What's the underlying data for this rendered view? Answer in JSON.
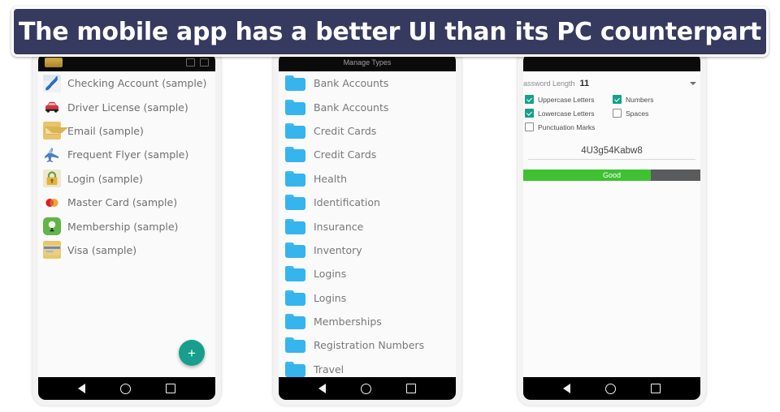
{
  "banner": {
    "text": "The mobile app has a better UI than its PC counterpart",
    "bg_color": "#373a5f",
    "text_color": "#ffffff"
  },
  "phones": {
    "entries_phone": {
      "topbar": {
        "title": "",
        "thumb_icon": "yellow-thumbnail-icon",
        "menu_icon": "overflow-menu-icon"
      },
      "entries": [
        {
          "label": "Checking Account (sample)",
          "icon": "checkbook-icon"
        },
        {
          "label": "Driver License (sample)",
          "icon": "car-icon"
        },
        {
          "label": "Email (sample)",
          "icon": "envelope-icon"
        },
        {
          "label": "Frequent Flyer (sample)",
          "icon": "airplane-icon"
        },
        {
          "label": "Login (sample)",
          "icon": "padlock-icon"
        },
        {
          "label": "Master Card (sample)",
          "icon": "mastercard-icon"
        },
        {
          "label": "Membership (sample)",
          "icon": "golf-ball-icon"
        },
        {
          "label": "Visa (sample)",
          "icon": "visa-card-icon"
        }
      ],
      "fab": {
        "label": "+",
        "color": "#179e8d"
      },
      "navbar": {
        "back": "back-icon",
        "home": "home-icon",
        "recents": "recents-icon"
      }
    },
    "types_phone": {
      "topbar": {
        "title": "Manage Types"
      },
      "types": [
        {
          "label": "Bank Accounts",
          "icon": "folder-icon"
        },
        {
          "label": "Bank Accounts",
          "icon": "folder-icon"
        },
        {
          "label": "Credit Cards",
          "icon": "folder-icon"
        },
        {
          "label": "Credit Cards",
          "icon": "folder-icon"
        },
        {
          "label": "Health",
          "icon": "folder-icon"
        },
        {
          "label": "Identification",
          "icon": "folder-icon"
        },
        {
          "label": "Insurance",
          "icon": "folder-icon"
        },
        {
          "label": "Inventory",
          "icon": "folder-icon"
        },
        {
          "label": "Logins",
          "icon": "folder-icon"
        },
        {
          "label": "Logins",
          "icon": "folder-icon"
        },
        {
          "label": "Memberships",
          "icon": "folder-icon"
        },
        {
          "label": "Registration Numbers",
          "icon": "folder-icon"
        },
        {
          "label": "Travel",
          "icon": "folder-icon"
        }
      ],
      "navbar": {
        "back": "back-icon",
        "home": "home-icon",
        "recents": "recents-icon"
      }
    },
    "generator_phone": {
      "length_label": "Password Length",
      "length_value": "11",
      "options": [
        {
          "label": "Uppercase Letters",
          "checked": true
        },
        {
          "label": "Numbers",
          "checked": true
        },
        {
          "label": "Lowercase Letters",
          "checked": true
        },
        {
          "label": "Spaces",
          "checked": false
        },
        {
          "label": "Punctuation Marks",
          "checked": false
        }
      ],
      "generated_password": "4U3g54Kabw8",
      "strength": {
        "label": "Good",
        "percent": 72,
        "fill_color": "#3ec232",
        "track_color": "#5a5b5d"
      },
      "navbar": {
        "back": "back-icon",
        "home": "home-icon",
        "recents": "recents-icon"
      }
    }
  }
}
